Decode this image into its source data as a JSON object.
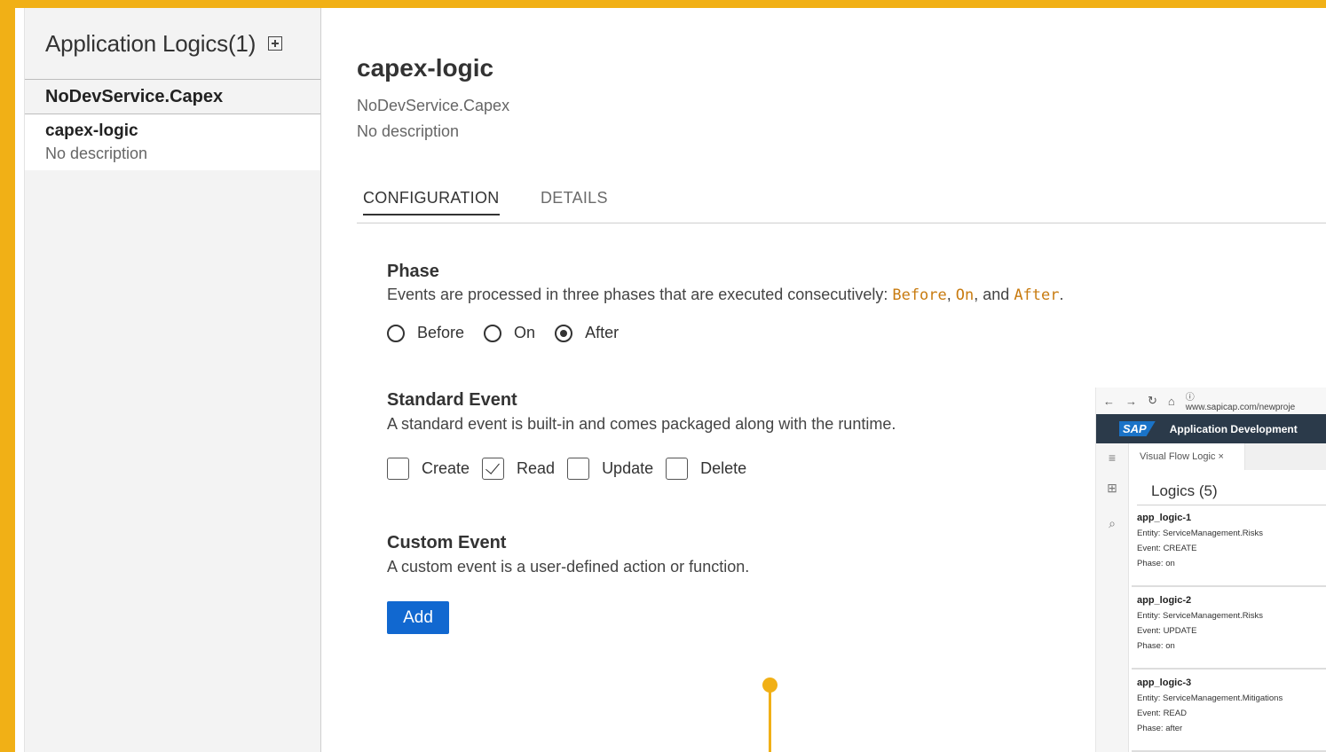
{
  "sidebar": {
    "title": "Application Logics(1)",
    "group": "NoDevService.Capex",
    "items": [
      {
        "name": "capex-logic",
        "description": "No description"
      }
    ]
  },
  "main": {
    "title": "capex-logic",
    "service": "NoDevService.Capex",
    "description": "No description",
    "tabs": [
      {
        "label": "CONFIGURATION",
        "active": true
      },
      {
        "label": "DETAILS",
        "active": false
      }
    ],
    "phase": {
      "title": "Phase",
      "text_prefix": "Events are processed in three phases that are executed consecutively: ",
      "kw1": "Before",
      "sep1": ", ",
      "kw2": "On",
      "sep2": ", and ",
      "kw3": "After",
      "end": ".",
      "options": [
        "Before",
        "On",
        "After"
      ],
      "selected": "After"
    },
    "standard_event": {
      "title": "Standard Event",
      "text": "A standard event is built-in and comes packaged along with the runtime.",
      "options": [
        "Create",
        "Read",
        "Update",
        "Delete"
      ],
      "checked": [
        "Read"
      ]
    },
    "custom_event": {
      "title": "Custom Event",
      "text": "A custom event is a user-defined action or function.",
      "button": "Add"
    }
  },
  "inset": {
    "url": "www.sapicap.com/newproje",
    "brand": "SAP",
    "app_title": "Application Development",
    "tab": "Visual Flow Logic",
    "logics_title": "Logics (5)",
    "logics": [
      {
        "name": "app_logic-1",
        "entity": "Entity: ServiceManagement.Risks",
        "event": "Event: CREATE",
        "phase": "Phase: on"
      },
      {
        "name": "app_logic-2",
        "entity": "Entity: ServiceManagement.Risks",
        "event": "Event: UPDATE",
        "phase": "Phase: on"
      },
      {
        "name": "app_logic-3",
        "entity": "Entity: ServiceManagement.Mitigations",
        "event": "Event: READ",
        "phase": "Phase: after"
      }
    ]
  },
  "colors": {
    "frame": "#F1B016",
    "accent": "#1168D0",
    "keyword": "#C87B10"
  }
}
